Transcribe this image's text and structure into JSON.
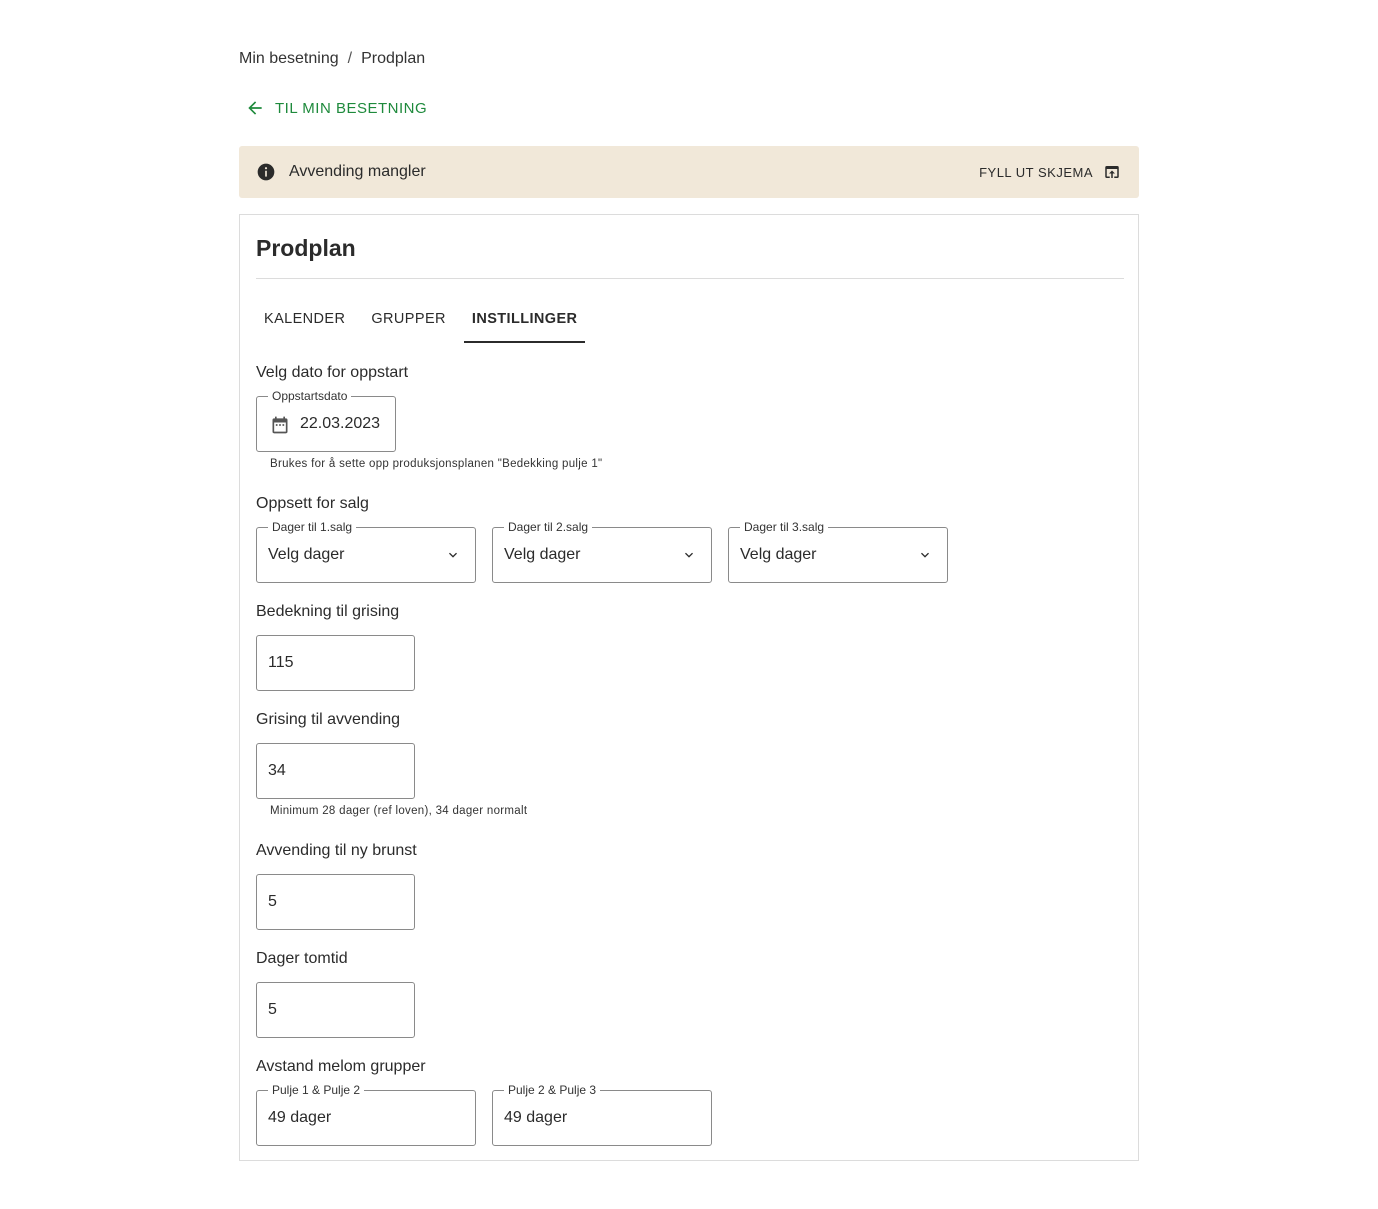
{
  "breadcrumb": {
    "items": [
      "Min besetning",
      "Prodplan"
    ],
    "separator": "/"
  },
  "back_link": {
    "label": "TIL MIN BESETNING"
  },
  "alert": {
    "text": "Avvending mangler",
    "action_label": "FYLL UT SKJEMA"
  },
  "card": {
    "title": "Prodplan",
    "tabs": [
      {
        "label": "KALENDER",
        "active": false
      },
      {
        "label": "GRUPPER",
        "active": false
      },
      {
        "label": "INSTILLINGER",
        "active": true
      }
    ]
  },
  "startup": {
    "section_label": "Velg dato for oppstart",
    "field_legend": "Oppstartsdato",
    "value": "22.03.2023",
    "helper": "Brukes for å sette opp produksjonsplanen \"Bedekking pulje 1\""
  },
  "sales": {
    "section_label": "Oppsett for salg",
    "selects": [
      {
        "legend": "Dager til 1.salg",
        "value": "Velg dager"
      },
      {
        "legend": "Dager til 2.salg",
        "value": "Velg dager"
      },
      {
        "legend": "Dager til 3.salg",
        "value": "Velg dager"
      }
    ]
  },
  "bedekning": {
    "section_label": "Bedekning til grising",
    "value": "115"
  },
  "grising": {
    "section_label": "Grising til avvending",
    "value": "34",
    "helper": "Minimum 28 dager (ref loven), 34 dager normalt"
  },
  "avvending": {
    "section_label": "Avvending til ny brunst",
    "value": "5"
  },
  "tomtid": {
    "section_label": "Dager tomtid",
    "value": "5"
  },
  "avstand": {
    "section_label": "Avstand melom grupper",
    "fields": [
      {
        "legend": "Pulje 1 & Pulje 2",
        "value": "49 dager"
      },
      {
        "legend": "Pulje 2 & Pulje 3",
        "value": "49 dager"
      }
    ]
  },
  "colors": {
    "accent_green": "#1e8a3c",
    "alert_bg": "#f1e8d9",
    "text": "#2b2b2b",
    "border": "#8a8a8a"
  }
}
